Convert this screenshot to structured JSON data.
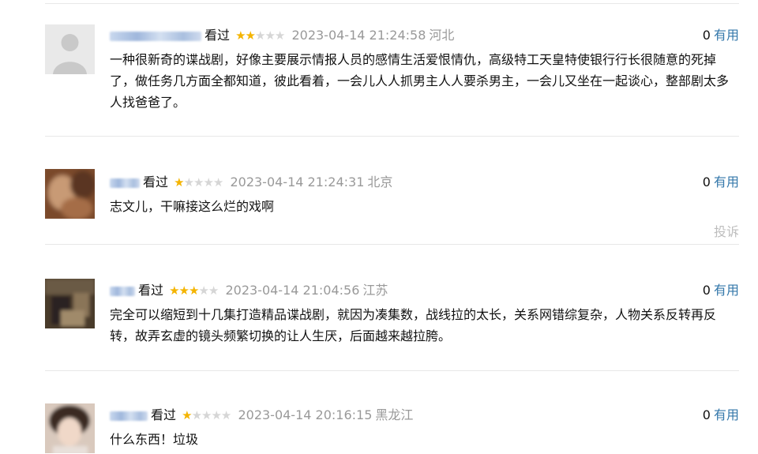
{
  "comments": [
    {
      "watched": "看过",
      "rating": 2,
      "time": "2023-04-14 21:24:58",
      "location": "河北",
      "useful_count": "0",
      "useful_label": "有用",
      "text": "一种很新奇的谍战剧，好像主要展示情报人员的感情生活爱恨情仇，高级特工天皇特使银行行长很随意的死掉了，做任务几方面全都知道，彼此看着，一会儿人人抓男主人人要杀男主，一会儿又坐在一起谈心，整部剧太多人找爸爸了。"
    },
    {
      "watched": "看过",
      "rating": 1,
      "time": "2023-04-14 21:24:31",
      "location": "北京",
      "useful_count": "0",
      "useful_label": "有用",
      "text": "志文儿，干嘛接这么烂的戏啊",
      "report": "投诉"
    },
    {
      "watched": "看过",
      "rating": 3,
      "time": "2023-04-14 21:04:56",
      "location": "江苏",
      "useful_count": "0",
      "useful_label": "有用",
      "text": "完全可以缩短到十几集打造精品谍战剧，就因为凑集数，战线拉的太长，关系网错综复杂，人物关系反转再反转，故弄玄虚的镜头频繁切换的让人生厌，后面越来越拉胯。"
    },
    {
      "watched": "看过",
      "rating": 1,
      "time": "2023-04-14 20:16:15",
      "location": "黑龙江",
      "useful_count": "0",
      "useful_label": "有用",
      "text": "什么东西！垃圾"
    }
  ],
  "colors": {
    "star_on": "#f4b400",
    "star_off": "#d6d6d6",
    "link": "#3377aa",
    "muted": "#999999"
  }
}
